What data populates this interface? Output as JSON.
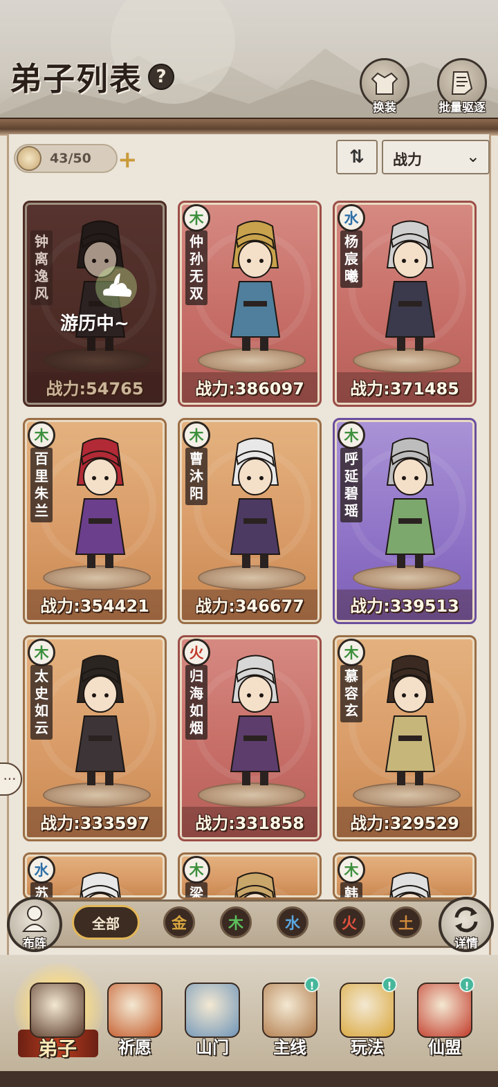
{
  "header": {
    "title": "弟子列表",
    "help": "?",
    "buttons": [
      {
        "label": "换装",
        "icon": "costume-icon"
      },
      {
        "label": "批量驱逐",
        "icon": "expel-icon"
      }
    ]
  },
  "toolbar": {
    "count": "43/50",
    "add": "+",
    "sort_icon": "⇅",
    "sort_value": "战力",
    "chevron": "⌄"
  },
  "cards": [
    {
      "name": "钟离逸风",
      "element": "",
      "power": "战力:54765",
      "status": "游历中~",
      "color": "dark"
    },
    {
      "name": "仲孙无双",
      "element": "木",
      "power": "战力:386097",
      "color": "red"
    },
    {
      "name": "杨宸曦",
      "element": "水",
      "power": "战力:371485",
      "color": "red"
    },
    {
      "name": "百里朱兰",
      "element": "木",
      "power": "战力:354421",
      "color": "orange"
    },
    {
      "name": "曹沐阳",
      "element": "木",
      "power": "战力:346677",
      "color": "orange"
    },
    {
      "name": "呼延碧瑶",
      "element": "木",
      "power": "战力:339513",
      "color": "purple"
    },
    {
      "name": "太史如云",
      "element": "木",
      "power": "战力:333597",
      "color": "orange"
    },
    {
      "name": "归海如烟",
      "element": "火",
      "power": "战力:331858",
      "color": "red"
    },
    {
      "name": "慕容玄",
      "element": "木",
      "power": "战力:329529",
      "color": "orange"
    },
    {
      "name": "苏",
      "element": "水",
      "power": "",
      "color": "orange"
    },
    {
      "name": "梁",
      "element": "木",
      "power": "",
      "color": "orange"
    },
    {
      "name": "韩",
      "element": "木",
      "power": "",
      "color": "orange"
    }
  ],
  "filter": {
    "left_button": "布阵",
    "right_button": "详情",
    "all": "全部",
    "elements": [
      "金",
      "木",
      "水",
      "火",
      "土"
    ]
  },
  "nav": [
    {
      "label": "弟子",
      "active": true
    },
    {
      "label": "祈愿"
    },
    {
      "label": "山门"
    },
    {
      "label": "主线",
      "badge": "!"
    },
    {
      "label": "玩法",
      "badge": "!"
    },
    {
      "label": "仙盟",
      "badge": "!"
    }
  ],
  "side_bubble": "···",
  "colors": {
    "wood": "#3c8f3c",
    "water": "#2e6fa8",
    "fire": "#c23a2a",
    "gold": "#d8a640",
    "earth": "#c9853a"
  }
}
